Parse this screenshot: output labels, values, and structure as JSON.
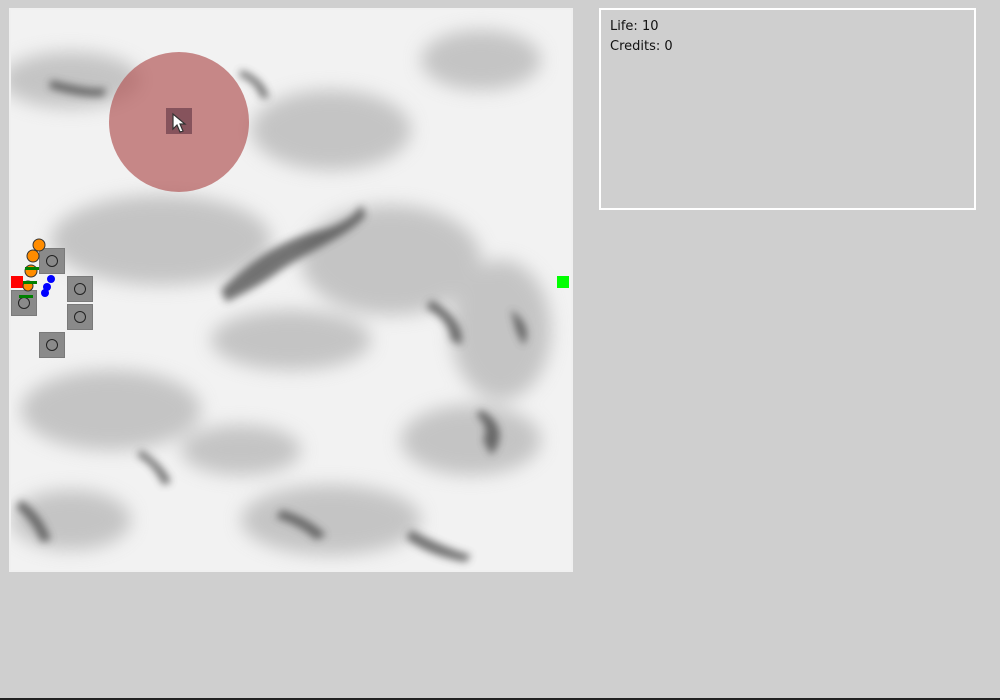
{
  "game": {
    "life_label": "Life: 10",
    "credits_label": "Credits: 0"
  },
  "colors": {
    "background": "#cfcfcf",
    "start_marker": "#ff0000",
    "goal_marker": "#00ff00",
    "range_circle": "#b35a5a",
    "tower_fill": "#8a8a8a",
    "creep_orange": "#ff8c00",
    "creep_blue": "#0000ff",
    "health_bar": "#008000"
  },
  "icons": {
    "start": "start-square-icon",
    "goal": "goal-square-icon",
    "cursor": "mouse-pointer-icon",
    "tower": "tower-ring-icon"
  }
}
